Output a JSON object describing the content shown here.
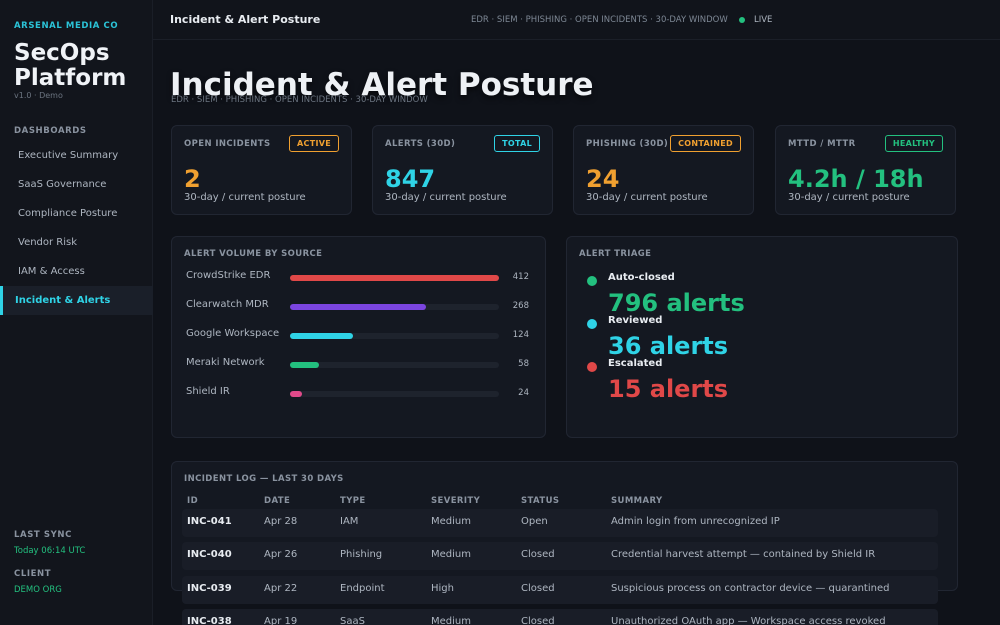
{
  "sidebar": {
    "brand": "ARSENAL MEDIA CO",
    "app_title_line1": "SecOps",
    "app_title_line2": "Platform",
    "version": "v1.0 · Demo",
    "nav_heading": "DASHBOARDS",
    "items": [
      {
        "label": "Executive Summary"
      },
      {
        "label": "SaaS Governance"
      },
      {
        "label": "Compliance Posture"
      },
      {
        "label": "Vendor Risk"
      },
      {
        "label": "IAM & Access"
      },
      {
        "label": "Incident & Alerts"
      }
    ],
    "last_sync_label": "LAST SYNC",
    "last_sync_value": "Today 06:14 UTC",
    "client_label": "CLIENT",
    "client_value": "DEMO ORG"
  },
  "topbar": {
    "title": "Incident & Alert Posture",
    "crumbs": "EDR · SIEM · PHISHING · OPEN INCIDENTS · 30-DAY WINDOW",
    "live_label": "LIVE"
  },
  "page": {
    "title": "Incident & Alert Posture",
    "subtitle": "EDR · SIEM · PHISHING · OPEN INCIDENTS · 30-DAY WINDOW"
  },
  "kpis": [
    {
      "label": "OPEN INCIDENTS",
      "badge": "ACTIVE",
      "value": "2",
      "sub": "30-day / current posture",
      "color": "#f0a030"
    },
    {
      "label": "ALERTS (30D)",
      "badge": "TOTAL",
      "value": "847",
      "sub": "30-day / current posture",
      "color": "#2fd3e6"
    },
    {
      "label": "PHISHING (30D)",
      "badge": "CONTAINED",
      "value": "24",
      "sub": "30-day / current posture",
      "color": "#f0a030"
    },
    {
      "label": "MTTD / MTTR",
      "badge": "HEALTHY",
      "value": "4.2h / 18h",
      "sub": "30-day / current posture",
      "color": "#23c07f"
    }
  ],
  "alert_volume": {
    "title": "ALERT VOLUME BY SOURCE",
    "max": 412,
    "sources": [
      {
        "label": "CrowdStrike EDR",
        "value": 412,
        "value_text": "412",
        "color": "#e04848"
      },
      {
        "label": "Clearwatch MDR",
        "value": 268,
        "value_text": "268",
        "color": "#7b45e0"
      },
      {
        "label": "Google Workspace",
        "value": 124,
        "value_text": "124",
        "color": "#2fd3e6"
      },
      {
        "label": "Meraki Network",
        "value": 58,
        "value_text": "58",
        "color": "#23c07f"
      },
      {
        "label": "Shield IR",
        "value": 24,
        "value_text": "24",
        "color": "#e04a8a"
      }
    ]
  },
  "triage": {
    "title": "ALERT TRIAGE",
    "items": [
      {
        "label": "Auto-closed",
        "value": "796 alerts",
        "color": "#23c07f"
      },
      {
        "label": "Reviewed",
        "value": "36 alerts",
        "color": "#2fd3e6"
      },
      {
        "label": "Escalated",
        "value": "15 alerts",
        "color": "#e04848"
      }
    ]
  },
  "incident_log": {
    "title": "INCIDENT LOG — LAST 30 DAYS",
    "columns": [
      "ID",
      "DATE",
      "TYPE",
      "SEVERITY",
      "STATUS",
      "SUMMARY"
    ],
    "rows": [
      {
        "id": "INC-041",
        "date": "Apr 28",
        "type": "IAM",
        "severity": "Medium",
        "status": "Open",
        "summary": "Admin login from unrecognized IP"
      },
      {
        "id": "INC-040",
        "date": "Apr 26",
        "type": "Phishing",
        "severity": "Medium",
        "status": "Closed",
        "summary": "Credential harvest attempt — contained by Shield IR"
      },
      {
        "id": "INC-039",
        "date": "Apr 22",
        "type": "Endpoint",
        "severity": "High",
        "status": "Closed",
        "summary": "Suspicious process on contractor device — quarantined"
      },
      {
        "id": "INC-038",
        "date": "Apr 19",
        "type": "SaaS",
        "severity": "Medium",
        "status": "Closed",
        "summary": "Unauthorized OAuth app — Workspace access revoked"
      }
    ]
  }
}
